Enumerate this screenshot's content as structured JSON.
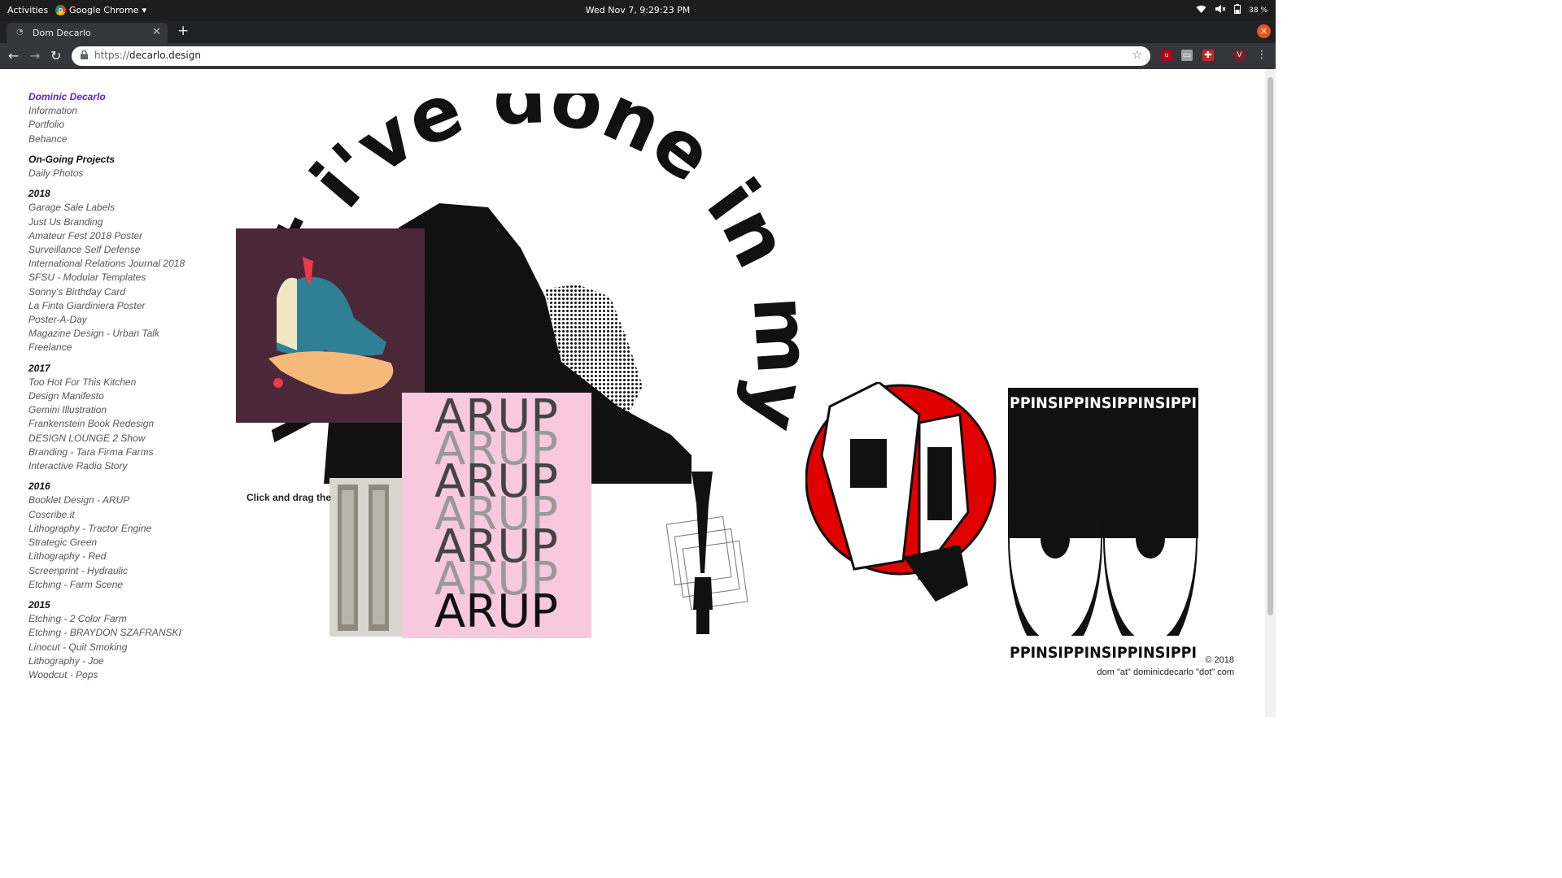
{
  "os": {
    "activities": "Activities",
    "app_name": "Google Chrome",
    "clock": "Wed Nov 7,  9:29:23 PM",
    "battery": "38 %"
  },
  "browser": {
    "tab_title": "Dom Decarlo",
    "url_prefix": "https://",
    "url_host": "decarlo.design",
    "profile_initial": "V"
  },
  "sidebar": {
    "name": "Dominic Decarlo",
    "links": [
      "Information",
      "Portfolio",
      "Behance"
    ],
    "sections": [
      {
        "heading": "On-Going Projects",
        "items": [
          "Daily Photos"
        ]
      },
      {
        "heading": "2018",
        "items": [
          "Garage Sale Labels",
          "Just Us Branding",
          "Amateur Fest 2018 Poster",
          "Surveillance Self Defense",
          "International Relations Journal 2018",
          "SFSU - Modular Templates",
          "Sonny's Birthday Card",
          "La Finta Giardiniera Poster",
          "Poster-A-Day",
          "Magazine Design - Urban Talk",
          "Freelance"
        ]
      },
      {
        "heading": "2017",
        "items": [
          "Too Hot For This Kitchen",
          "Design Manifesto",
          "Gemini Illustration",
          "Frankenstein Book Redesign",
          "DESIGN LOUNGE 2 Show",
          "Branding - Tara Firma Farms",
          "Interactive Radio Story"
        ]
      },
      {
        "heading": "2016",
        "items": [
          "Booklet Design - ARUP",
          "Coscribe.it",
          "Lithography - Tractor Engine",
          "Strategic Green",
          "Lithography - Red",
          "Screenprint - Hydraulic",
          "Etching - Farm Scene"
        ]
      },
      {
        "heading": "2015",
        "items": [
          "Etching - 2 Color Farm",
          "Etching - BRAYDON SZAFRANSKI",
          "Linocut - Quit Smoking",
          "Lithography - Joe",
          "Woodcut - Pops"
        ]
      }
    ]
  },
  "hero": {
    "arc_text": "what i've done in my twenties"
  },
  "main": {
    "instruction": "Click and drag the",
    "arup_word": "ARUP",
    "pins_word": "PPINSIPPINSIPPINSIPPI"
  },
  "footer": {
    "copyright": "© 2018",
    "email": "dom \"at\" dominicdecarlo \"dot\" com"
  },
  "colors": {
    "accent_link": "#5b1fd6",
    "poster_plum": "#4a2838",
    "arup_pink": "#f7c8e0",
    "sticker_red": "#e00000",
    "ubuntu_orange": "#e95420"
  }
}
